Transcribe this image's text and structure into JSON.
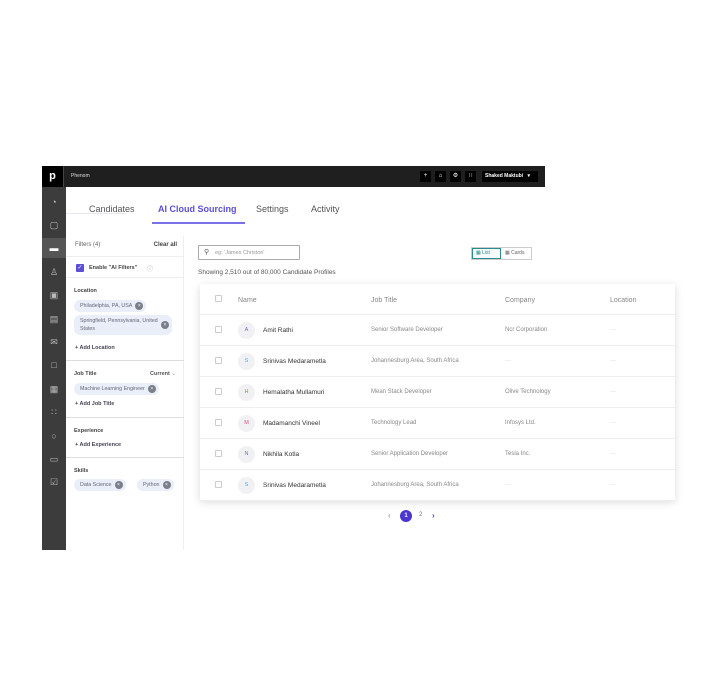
{
  "topbar": {
    "logo": "p",
    "app_name": "Phenom",
    "buttons": [
      {
        "icon": "plus-icon",
        "glyph": "+"
      },
      {
        "icon": "bell-icon",
        "glyph": "⌂"
      },
      {
        "icon": "gear-icon",
        "glyph": "⚙"
      },
      {
        "icon": "apps-grid-icon",
        "glyph": "∷"
      }
    ],
    "user": "Shaked Maktubi",
    "user_caret": "▾"
  },
  "sidenav": [
    {
      "icon": "dashboard-icon",
      "glyph": "◔",
      "active": false
    },
    {
      "icon": "briefcase-icon",
      "glyph": "▢",
      "active": false
    },
    {
      "icon": "monitor-icon",
      "glyph": "▬",
      "active": true
    },
    {
      "icon": "person-icon",
      "glyph": "♙",
      "active": false
    },
    {
      "icon": "id-badge-icon",
      "glyph": "▣",
      "active": false
    },
    {
      "icon": "list-icon",
      "glyph": "▤",
      "active": false
    },
    {
      "icon": "megaphone-icon",
      "glyph": "✉",
      "active": false
    },
    {
      "icon": "chat-icon",
      "glyph": "□",
      "active": false
    },
    {
      "icon": "calendar-icon",
      "glyph": "▦",
      "active": false
    },
    {
      "icon": "team-icon",
      "glyph": "∷",
      "active": false
    },
    {
      "icon": "shield-icon",
      "glyph": "○",
      "active": false
    },
    {
      "icon": "folder-icon",
      "glyph": "▭",
      "active": false
    },
    {
      "icon": "clipboard-check-icon",
      "glyph": "☑",
      "active": false
    }
  ],
  "tabs": [
    {
      "label": "Candidates",
      "active": false
    },
    {
      "label": "AI Cloud Sourcing",
      "active": true
    },
    {
      "label": "Settings",
      "active": false
    },
    {
      "label": "Activity",
      "active": false
    }
  ],
  "filters": {
    "header": "Filters (4)",
    "clear_all": "Clear all",
    "ai_filters_label": "Enable \"AI Filters\"",
    "ai_filters_checked": true,
    "location": {
      "title": "Location",
      "chips": [
        "Philadelphia, PA, USA",
        "Springfield, Pennsylvania, United States"
      ],
      "add_label": "Add Location"
    },
    "job_title": {
      "title": "Job Title",
      "scope": "Current",
      "chips": [
        "Machine Learning Engineer"
      ],
      "add_label": "Add Job Title"
    },
    "experience": {
      "title": "Experience",
      "add_label": "Add Experience"
    },
    "skills": {
      "title": "Skills",
      "chips": [
        "Data Science",
        "Python"
      ]
    }
  },
  "search": {
    "placeholder": "eg: 'James Christon'"
  },
  "view_toggle": {
    "list": "List",
    "cards": "Cards",
    "active": "List"
  },
  "showing_text": "Showing 2,510 out of 80,000 Candidate Profiles",
  "table": {
    "columns": [
      "Name",
      "Job Title",
      "Company",
      "Location"
    ],
    "rows": [
      {
        "initial": "A",
        "initial_color": "#6b6fe0",
        "name": "Amit Rathi",
        "job_title": "Senior Software Developer",
        "company": "Ncr Corporation",
        "location": "—"
      },
      {
        "initial": "S",
        "initial_color": "#4aa8e8",
        "name": "Srinivas Medarametla",
        "job_title": "Johannesburg Area, South Africa",
        "company": "—",
        "location": "—"
      },
      {
        "initial": "H",
        "initial_color": "#4cb86a",
        "name": "Hemalatha Mullamuri",
        "job_title": "Mean Stack Developer",
        "company": "Olive Technology",
        "location": "—"
      },
      {
        "initial": "M",
        "initial_color": "#e0507a",
        "name": "Madamanchi Vineel",
        "job_title": "Technology Lead",
        "company": "Infosys Ltd.",
        "location": "—"
      },
      {
        "initial": "N",
        "initial_color": "#6b6fe0",
        "name": "Nikhila Kotla",
        "job_title": "Senior Application Developer",
        "company": "Tesla Inc.",
        "location": "—"
      },
      {
        "initial": "S",
        "initial_color": "#4aa8e8",
        "name": "Srinivas Medarametla",
        "job_title": "Johannesburg Area, South Africa",
        "company": "—",
        "location": "—"
      }
    ]
  },
  "pagination": {
    "prev": "‹",
    "pages": [
      "1",
      "2"
    ],
    "current": "1",
    "next": "›"
  },
  "colors": {
    "accent": "#5a4fd6",
    "topbar": "#1f1f1f",
    "sidenav": "#3c3c3c",
    "teal": "#2a8c8c"
  }
}
